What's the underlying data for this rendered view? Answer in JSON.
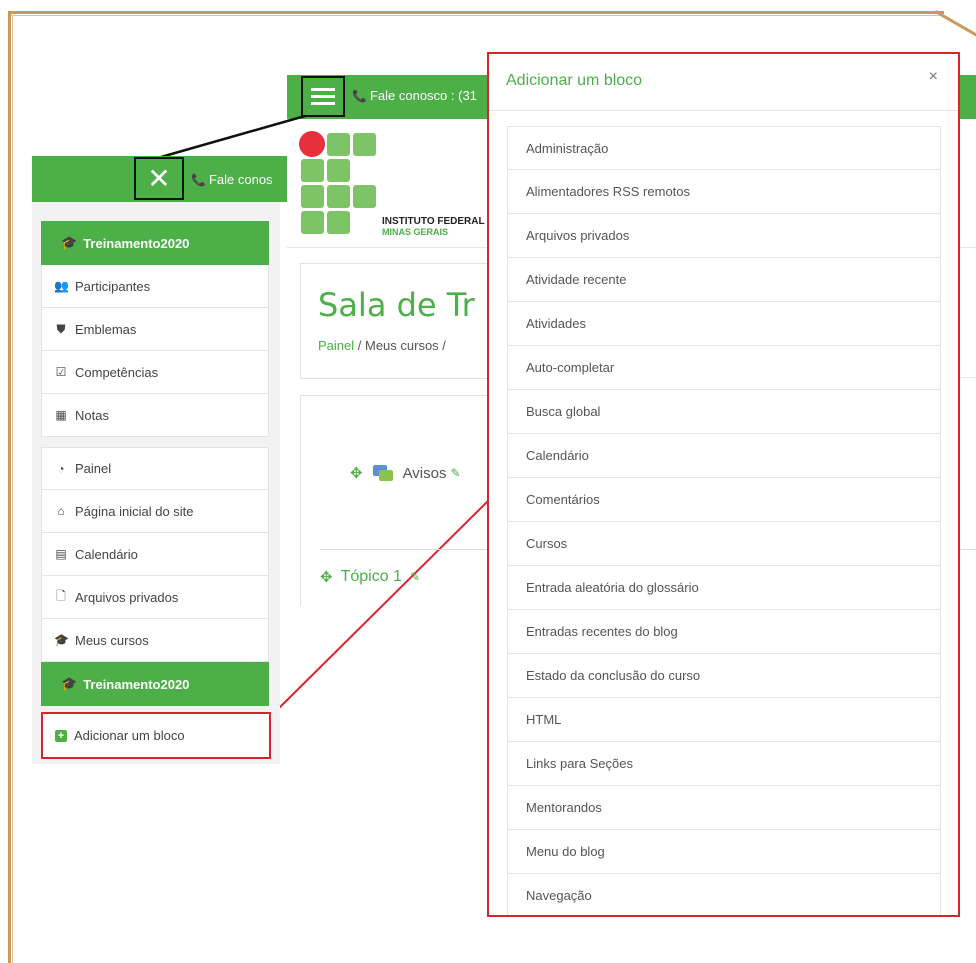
{
  "topbar": {
    "contact_label": "Fale conosco : (31",
    "menu_icon": "hamburger-icon"
  },
  "logo": {
    "line1": "INSTITUTO FEDERAL",
    "line2": "MINAS GERAIS"
  },
  "course": {
    "title": "Sala de Tr",
    "breadcrumb_home": "Painel",
    "breadcrumb_sep1": " / ",
    "breadcrumb_courses": "Meus cursos",
    "breadcrumb_sep2": " /"
  },
  "content": {
    "avisos_label": "Avisos",
    "topico_label": "Tópico 1"
  },
  "drawer": {
    "contact_label": "Fale conos",
    "close_icon": "close-icon",
    "course_heading": "Treinamento2020",
    "course_items": [
      {
        "label": "Participantes",
        "icon": "users-icon"
      },
      {
        "label": "Emblemas",
        "icon": "shield-icon"
      },
      {
        "label": "Competências",
        "icon": "checkbox-icon"
      },
      {
        "label": "Notas",
        "icon": "table-icon"
      }
    ],
    "site_items": [
      {
        "label": "Painel",
        "icon": "dashboard-icon"
      },
      {
        "label": "Página inicial do site",
        "icon": "home-icon"
      },
      {
        "label": "Calendário",
        "icon": "calendar-icon"
      },
      {
        "label": "Arquivos privados",
        "icon": "file-icon"
      },
      {
        "label": "Meus cursos",
        "icon": "graduation-cap-icon"
      }
    ],
    "second_heading": "Treinamento2020",
    "add_block_label": "Adicionar um bloco"
  },
  "modal": {
    "title": "Adicionar um bloco",
    "close_label": "×",
    "items": [
      "Administração",
      "Alimentadores RSS remotos",
      "Arquivos privados",
      "Atividade recente",
      "Atividades",
      "Auto-completar",
      "Busca global",
      "Calendário",
      "Comentários",
      "Cursos",
      "Entrada aleatória do glossário",
      "Entradas recentes do blog",
      "Estado da conclusão do curso",
      "HTML",
      "Links para Seções",
      "Mentorandos",
      "Menu do blog",
      "Navegação"
    ]
  },
  "colors": {
    "brand_green": "#4caf47",
    "highlight_red": "#d8242b",
    "logo_red": "#e8303a",
    "frame_gold": "#c89a5b"
  }
}
